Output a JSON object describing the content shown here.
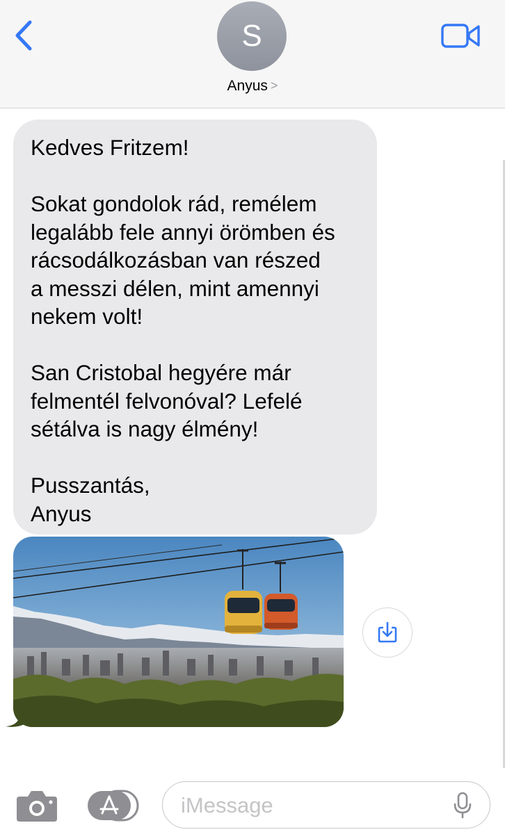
{
  "header": {
    "avatar_initial": "S",
    "contact_name": "Anyus",
    "chevron": ">"
  },
  "message": {
    "lines": [
      "Kedves Fritzem!",
      "",
      "Sokat gondolok rád, remélem",
      "legalább fele annyi örömben és",
      "rácsodálkozásban van részed",
      "a messzi délen, mint amennyi",
      "nekem volt!",
      "",
      "San Cristobal hegyére már",
      "felmentél felvonóval? Lefelé",
      "sétálva is nagy élmény!",
      "",
      "Pusszantás,",
      "Anyus"
    ]
  },
  "attachment": {
    "kind": "photo",
    "icon": "download-icon"
  },
  "input": {
    "placeholder": "iMessage"
  },
  "colors": {
    "accent": "#3478f6",
    "bubble_received": "#e9e9eb",
    "header_bg": "#f6f6f6",
    "icon_gray": "#8e8e93"
  },
  "icons": [
    "back-chevron-icon",
    "video-camera-icon",
    "camera-icon",
    "app-store-icon",
    "microphone-icon",
    "download-icon"
  ]
}
